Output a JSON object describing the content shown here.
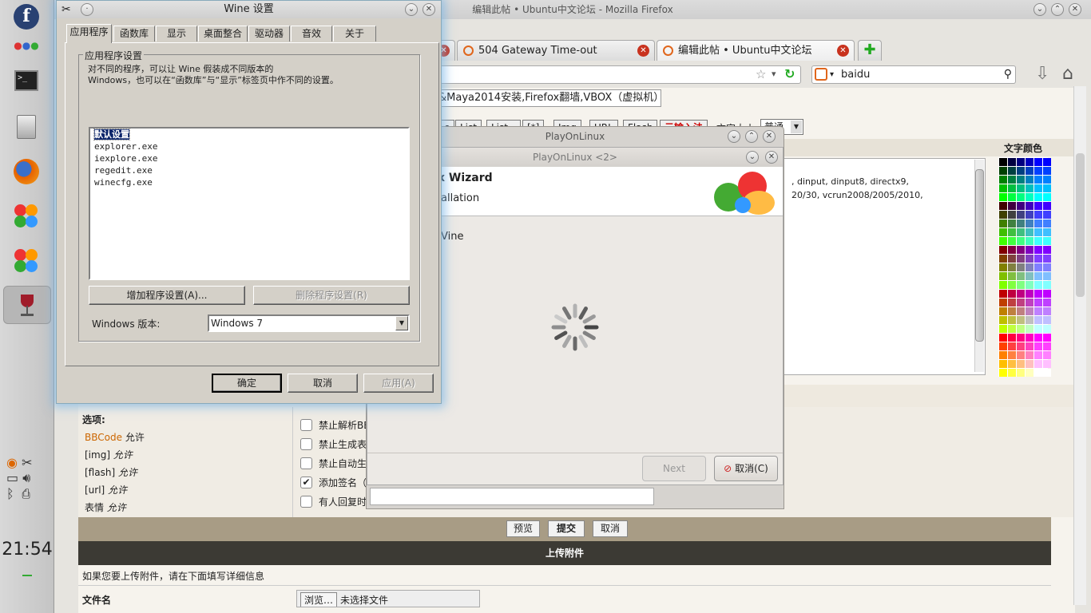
{
  "dock": {
    "clock": "21:54",
    "items": [
      "fedora-logo",
      "apps",
      "terminal",
      "files",
      "firefox",
      "playonlinux",
      "playonlinux-2",
      "wine-config"
    ]
  },
  "firefox": {
    "title": "编辑此帖 • Ubuntu中文论坛 - Mozilla Firefox",
    "tabs": [
      "504 Gateway Time-out",
      "编辑此帖 • Ubuntu中文论坛"
    ],
    "search_engine_value": "baidu",
    "post_title_value": "&Maya2014安装,Firefox翻墙,VBOX（虚拟机）,",
    "bbcode_buttons": [
      "e",
      "List",
      "List=",
      "[*]",
      "Img",
      "URL",
      "Flash",
      "云输入法"
    ],
    "font_size_label": "文字大小:",
    "font_size_value": "普通",
    "color_label": "文字颜色",
    "editor_text_line1": ", dinput, dinput8, directx9,",
    "editor_text_line2": "20/30, vcrun2008/2005/2010,",
    "options_label": "选项:",
    "option_lines": [
      {
        "link": "BBCode",
        "state": "允许"
      },
      {
        "link": "[img]",
        "state": "允许"
      },
      {
        "link": "[flash]",
        "state": "允许"
      },
      {
        "link": "[url]",
        "state": "允许"
      },
      {
        "link": "表情",
        "state": "允许"
      }
    ],
    "checkboxes": [
      {
        "label": "禁止解析BB",
        "checked": false
      },
      {
        "label": "禁止生成表",
        "checked": false
      },
      {
        "label": "禁止自动生",
        "checked": false
      },
      {
        "label": "添加签名（",
        "checked": true
      },
      {
        "label": "有人回复时",
        "checked": false
      }
    ],
    "actions": [
      "预览",
      "提交",
      "取消"
    ],
    "attach_header": "上传附件",
    "attach_hint": "如果您要上传附件，请在下面填写详细信息",
    "file_label": "文件名",
    "browse_label": "浏览…",
    "no_file_label": "未选择文件"
  },
  "wine": {
    "title": "Wine 设置",
    "tabs": [
      "应用程序",
      "函数库",
      "显示",
      "桌面整合",
      "驱动器",
      "音效",
      "关于"
    ],
    "group_label": "应用程序设置",
    "desc_line1": "对不同的程序，可以让 Wine 假装成不同版本的",
    "desc_line2": "Windows，也可以在“函数库”与“显示”标签页中作不同的设置。",
    "apps": [
      "默认设置",
      "explorer.exe",
      "iexplore.exe",
      "regedit.exe",
      "winecfg.exe"
    ],
    "add_button": "增加程序设置(A)...",
    "remove_button": "删除程序设置(R)",
    "version_label": "Windows 版本:",
    "version_value": "Windows 7",
    "ok_button": "确定",
    "cancel_button": "取消",
    "apply_button": "应用(A)"
  },
  "playonlinux": {
    "back_title": "PlayOnLinux",
    "front_title": "PlayOnLinux <2>",
    "heading": "x Wizard",
    "subheading": "allation",
    "body_text": "Vine",
    "next_button": "Next",
    "cancel_button": "取消(C)"
  }
}
